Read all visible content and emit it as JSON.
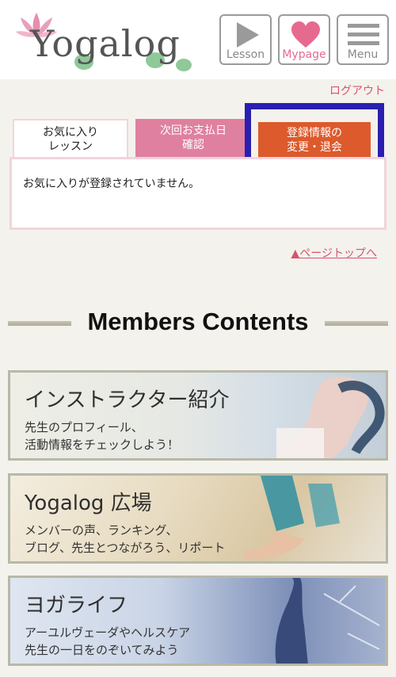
{
  "header": {
    "logo_text": "Yogalog",
    "buttons": {
      "lesson": "Lesson",
      "mypage": "Mypage",
      "menu": "Menu"
    }
  },
  "logout_label": "ログアウト",
  "tabs": {
    "favorites": [
      "お気に入り",
      "レッスン"
    ],
    "next_payment": [
      "次回お支払日",
      "確認"
    ],
    "registration": [
      "登録情報の",
      "変更・退会"
    ]
  },
  "favorites_panel": {
    "message": "お気に入りが登録されていません。"
  },
  "page_top_label": "▲ページトップへ",
  "members_contents": {
    "title": "Members Contents",
    "banners": [
      {
        "title": "インストラクター紹介",
        "lines": [
          "先生のプロフィール、",
          "活動情報をチェックしよう！"
        ]
      },
      {
        "title": "Yogalog 広場",
        "lines": [
          "メンバーの声、ランキング、",
          "ブログ、先生とつながろう、リポート"
        ]
      },
      {
        "title": "ヨガライフ",
        "lines": [
          "アーユルヴェーダやヘルスケア",
          "先生の一日をのぞいてみよう"
        ]
      }
    ]
  },
  "colors": {
    "accent_pink": "#e66a8f",
    "tab_pink": "#df80a0",
    "tab_orange": "#dc5a2c",
    "highlight_blue": "#2b1fb0"
  }
}
